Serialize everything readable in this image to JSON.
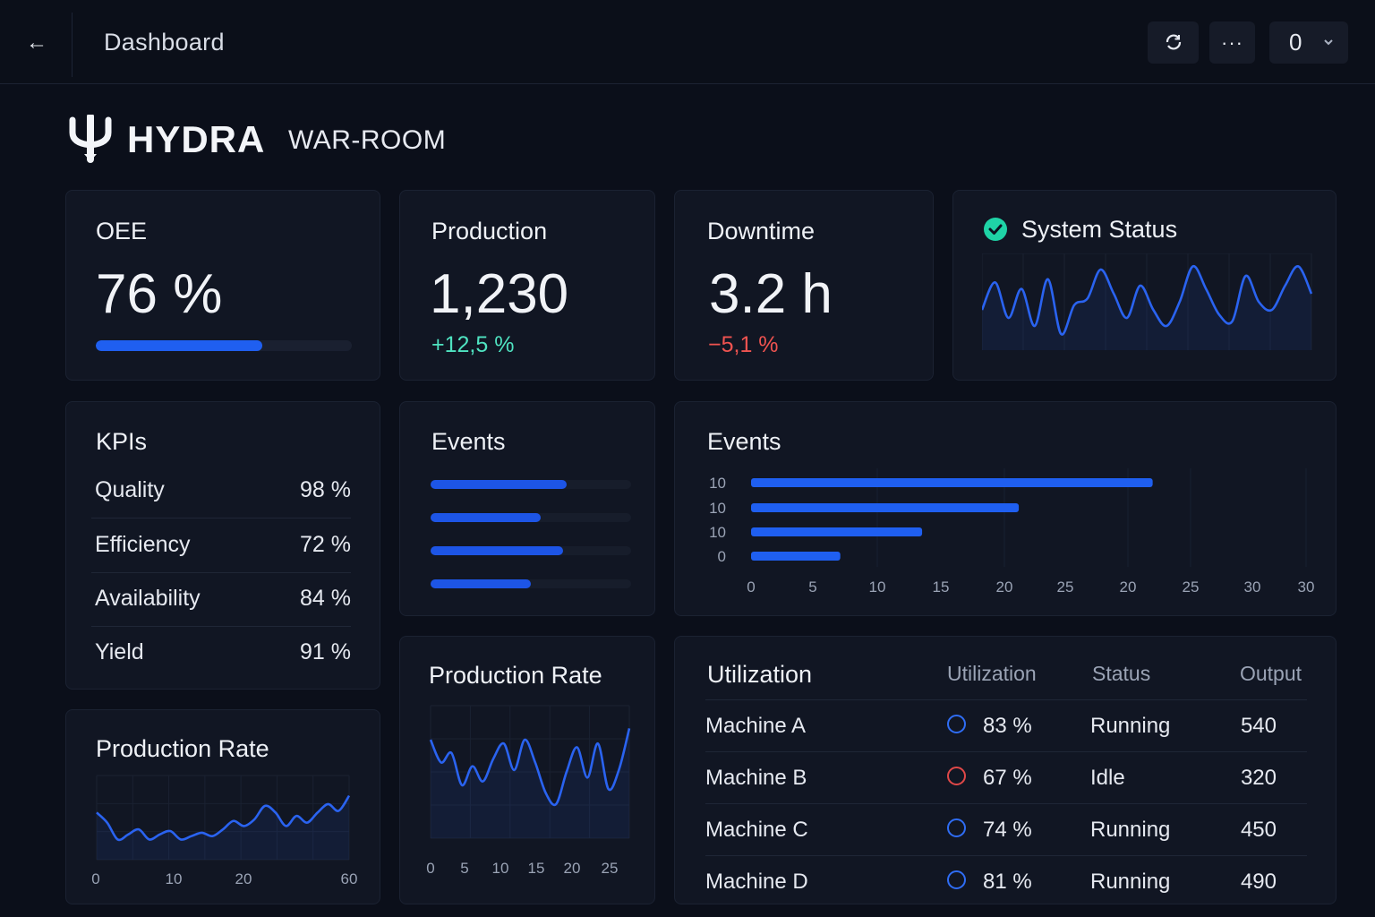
{
  "topbar": {
    "back_icon": "arrow-left-icon",
    "title": "Dashboard",
    "refresh_icon": "refresh-icon",
    "more_icon": "more-horizontal-icon",
    "more_label": "···",
    "account_value": "0",
    "chevron_icon": "chevron-down-icon"
  },
  "brand": {
    "logo_icon": "trident-icon",
    "name": "HYDRA",
    "subtitle": "WAR-ROOM"
  },
  "colors": {
    "background": "#0b0f1a",
    "card": "#111623",
    "accent": "#1f5ff0",
    "positive": "#4fe3c1",
    "negative": "#ef5350",
    "status_ok": "#1fd3a6"
  },
  "oee": {
    "title": "OEE",
    "value": "76 %",
    "progress": 0.65
  },
  "production": {
    "title": "Production",
    "value": "1,230",
    "delta": "+12,5 %"
  },
  "downtime": {
    "title": "Downtime",
    "value": "3.2 h",
    "delta": "−5,1 %"
  },
  "system_status": {
    "title": "System Status",
    "status_icon": "check-circle-icon"
  },
  "kpis": {
    "title": "KPIs",
    "rows": [
      {
        "label": "Quality",
        "value": "98 %"
      },
      {
        "label": "Efficiency",
        "value": "72 %"
      },
      {
        "label": "Availability",
        "value": "84 %"
      },
      {
        "label": "Yield",
        "value": "91 %"
      }
    ]
  },
  "events_small": {
    "title": "Events"
  },
  "events_large": {
    "title": "Events"
  },
  "production_rate_small": {
    "title": "Production Rate"
  },
  "production_rate_tall": {
    "title": "Production Rate"
  },
  "utilization": {
    "title": "Utilization",
    "columns": [
      "Utilization",
      "Status",
      "Output"
    ],
    "rows": [
      {
        "name": "Machine A",
        "utilization": "83 %",
        "status": "Running",
        "output": "540",
        "ring_color": "#2f6df5"
      },
      {
        "name": "Machine B",
        "utilization": "67 %",
        "status": "Idle",
        "output": "320",
        "ring_color": "#e04848"
      },
      {
        "name": "Machine C",
        "utilization": "74 %",
        "status": "Running",
        "output": "450",
        "ring_color": "#2f6df5"
      },
      {
        "name": "Machine D",
        "utilization": "81 %",
        "status": "Running",
        "output": "490",
        "ring_color": "#2f6df5"
      }
    ]
  },
  "chart_data": [
    {
      "id": "system_status",
      "type": "line",
      "series": [
        {
          "values": [
            45,
            62,
            40,
            58,
            35,
            64,
            30,
            48,
            52,
            70,
            55,
            40,
            60,
            45,
            35,
            50,
            72,
            58,
            42,
            38,
            66,
            50,
            45,
            60,
            72,
            55
          ]
        }
      ],
      "grid": true
    },
    {
      "id": "events_small",
      "type": "bar",
      "orientation": "horizontal",
      "values": [
        0.68,
        0.55,
        0.66,
        0.5
      ],
      "max": 1
    },
    {
      "id": "events_large",
      "type": "bar",
      "orientation": "horizontal",
      "categories": [
        "10",
        "10",
        "10",
        "0"
      ],
      "values": [
        27,
        18,
        11.5,
        6
      ],
      "x_ticks": [
        "0",
        "5",
        "10",
        "15",
        "20",
        "25",
        "20",
        "25",
        "30",
        "30"
      ],
      "grid": true
    },
    {
      "id": "production_rate_small",
      "type": "area",
      "series": [
        {
          "values": [
            38,
            32,
            22,
            25,
            28,
            22,
            25,
            27,
            22,
            24,
            26,
            24,
            28,
            33,
            30,
            34,
            42,
            38,
            30,
            36,
            32,
            38,
            43,
            39,
            48
          ]
        }
      ],
      "x_ticks": [
        "0",
        "10",
        "20",
        "60"
      ],
      "grid": true
    },
    {
      "id": "production_rate_tall",
      "type": "area",
      "series": [
        {
          "values": [
            62,
            50,
            55,
            38,
            48,
            40,
            52,
            60,
            46,
            62,
            50,
            34,
            28,
            45,
            58,
            42,
            60,
            36,
            46,
            68
          ]
        }
      ],
      "x_ticks": [
        "0",
        "5",
        "10",
        "15",
        "20",
        "25"
      ],
      "grid": true
    }
  ]
}
